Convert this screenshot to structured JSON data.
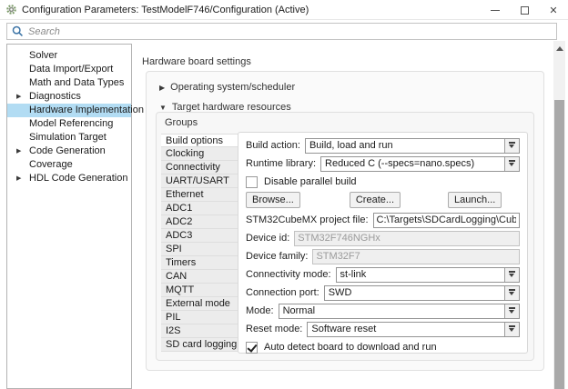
{
  "window": {
    "title": "Configuration Parameters: TestModelF746/Configuration (Active)",
    "icons": {
      "app": "gear-icon",
      "minimize": "minimize-icon",
      "maximize": "maximize-icon",
      "close": "close-icon"
    }
  },
  "search": {
    "placeholder": "Search",
    "icon": "search-icon"
  },
  "sidebar": {
    "items": [
      {
        "label": "Solver",
        "expandable": false,
        "selected": false
      },
      {
        "label": "Data Import/Export",
        "expandable": false,
        "selected": false
      },
      {
        "label": "Math and Data Types",
        "expandable": false,
        "selected": false
      },
      {
        "label": "Diagnostics",
        "expandable": true,
        "selected": false
      },
      {
        "label": "Hardware Implementation",
        "expandable": false,
        "selected": true
      },
      {
        "label": "Model Referencing",
        "expandable": false,
        "selected": false
      },
      {
        "label": "Simulation Target",
        "expandable": false,
        "selected": false
      },
      {
        "label": "Code Generation",
        "expandable": true,
        "selected": false
      },
      {
        "label": "Coverage",
        "expandable": false,
        "selected": false
      },
      {
        "label": "HDL Code Generation",
        "expandable": true,
        "selected": false
      }
    ],
    "selected_color": "#b2dcf3"
  },
  "main": {
    "heading": "Hardware board settings",
    "sections": [
      {
        "label": "Operating system/scheduler",
        "expanded": false,
        "arrow": "▶"
      },
      {
        "label": "Target hardware resources",
        "expanded": true,
        "arrow": "▼"
      }
    ],
    "groups_label": "Groups",
    "groups": {
      "items": [
        "Build options",
        "Clocking",
        "Connectivity",
        "UART/USART",
        "Ethernet",
        "ADC1",
        "ADC2",
        "ADC3",
        "SPI",
        "Timers",
        "CAN",
        "MQTT",
        "External mode",
        "PIL",
        "I2S",
        "SD card logging"
      ],
      "selected": "Build options"
    },
    "form": {
      "build_action": {
        "label": "Build action:",
        "value": "Build, load and run"
      },
      "runtime_library": {
        "label": "Runtime library:",
        "value": "Reduced C (--specs=nano.specs)"
      },
      "disable_parallel": {
        "label": "Disable parallel build",
        "checked": false
      },
      "buttons": [
        "Browse...",
        "Create...",
        "Launch..."
      ],
      "cubemx": {
        "label": "STM32CubeMX project file:",
        "value": "C:\\Targets\\SDCardLogging\\CubeMXWorkflow"
      },
      "device_id": {
        "label": "Device id:",
        "value": "STM32F746NGHx",
        "disabled": true
      },
      "device_family": {
        "label": "Device family:",
        "value": "STM32F7",
        "disabled": true
      },
      "connectivity_mode": {
        "label": "Connectivity mode:",
        "value": "st-link"
      },
      "connection_port": {
        "label": "Connection port:",
        "value": "SWD"
      },
      "mode": {
        "label": "Mode:",
        "value": "Normal"
      },
      "reset_mode": {
        "label": "Reset mode:",
        "value": "Software reset"
      },
      "auto_detect": {
        "label": "Auto detect board to download and run",
        "checked": true
      }
    }
  }
}
